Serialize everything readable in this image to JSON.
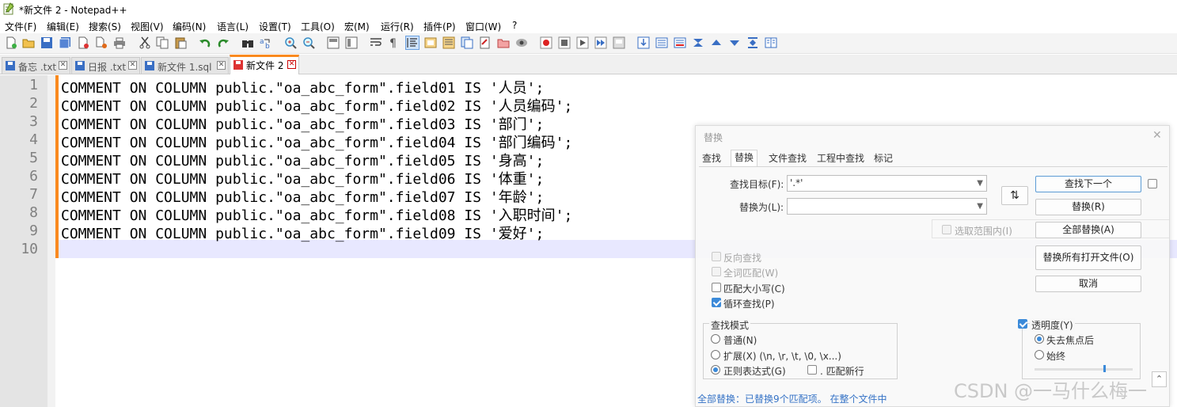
{
  "window": {
    "title": "*新文件 2 - Notepad++"
  },
  "menu": [
    "文件(F)",
    "编辑(E)",
    "搜索(S)",
    "视图(V)",
    "编码(N)",
    "语言(L)",
    "设置(T)",
    "工具(O)",
    "宏(M)",
    "运行(R)",
    "插件(P)",
    "窗口(W)",
    "?"
  ],
  "toolbar_icons": [
    "new-file-icon",
    "open-file-icon",
    "save-icon",
    "save-all-icon",
    "close-icon",
    "close-all-icon",
    "print-icon",
    "cut-icon",
    "copy-icon",
    "paste-icon",
    "undo-icon",
    "redo-icon",
    "find-icon",
    "replace-icon",
    "zoom-in-icon",
    "zoom-out-icon",
    "sync-v-icon",
    "sync-h-icon",
    "wrap-icon",
    "show-all-chars-icon",
    "indent-guide-icon",
    "lang-udl-icon",
    "doc-map-icon",
    "function-list-icon",
    "folder-workspace-icon",
    "monitor-icon",
    "record-macro-icon",
    "stop-record-icon",
    "play-macro-icon",
    "play-multi-icon",
    "save-macro-icon",
    "run-icon",
    "col-mode-icon",
    "prev-bookmark-icon",
    "fold-all-icon",
    "up-icon",
    "down-icon",
    "unfold-icon",
    "panel-icon"
  ],
  "tabs": [
    {
      "label": "备忘 .txt",
      "saved": true,
      "active": false
    },
    {
      "label": "日报 .txt",
      "saved": true,
      "active": false
    },
    {
      "label": "新文件 1.sql",
      "saved": true,
      "active": false
    },
    {
      "label": "新文件 2",
      "saved": false,
      "active": true
    }
  ],
  "editor": {
    "line_numbers": [
      "1",
      "2",
      "3",
      "4",
      "5",
      "6",
      "7",
      "8",
      "9",
      "10"
    ],
    "lines": [
      "COMMENT ON COLUMN public.\"oa_abc_form\".field01 IS '人员';",
      "COMMENT ON COLUMN public.\"oa_abc_form\".field02 IS '人员编码';",
      "COMMENT ON COLUMN public.\"oa_abc_form\".field03 IS '部门';",
      "COMMENT ON COLUMN public.\"oa_abc_form\".field04 IS '部门编码';",
      "COMMENT ON COLUMN public.\"oa_abc_form\".field05 IS '身高';",
      "COMMENT ON COLUMN public.\"oa_abc_form\".field06 IS '体重';",
      "COMMENT ON COLUMN public.\"oa_abc_form\".field07 IS '年龄';",
      "COMMENT ON COLUMN public.\"oa_abc_form\".field08 IS '入职时间';",
      "COMMENT ON COLUMN public.\"oa_abc_form\".field09 IS '爱好';",
      ""
    ]
  },
  "dialog": {
    "title": "替换",
    "close": "✕",
    "tabs": [
      "查找",
      "替换",
      "文件查找",
      "工程中查找",
      "标记"
    ],
    "find_label": "查找目标(F):",
    "find_value": "'.*'",
    "replace_label": "替换为(L):",
    "replace_value": "",
    "swap_glyph": "⇅",
    "in_selection": "选取范围内(I)",
    "buttons": {
      "find_next": "查找下一个",
      "replace": "替换(R)",
      "replace_all": "全部替换(A)",
      "replace_all_open": "替换所有打开文件(O)",
      "cancel": "取消"
    },
    "options": {
      "backward": "反向查找",
      "whole_word": "全词匹配(W)",
      "match_case": "匹配大小写(C)",
      "wrap": "循环查找(P)"
    },
    "search_mode": {
      "legend": "查找模式",
      "normal": "普通(N)",
      "extended": "扩展(X) (\\n, \\r, \\t, \\0, \\x...)",
      "regex": "正则表达式(G)",
      "dot_newline": ". 匹配新行"
    },
    "transparency": {
      "label": "透明度(Y)",
      "on_lose_focus": "失去焦点后",
      "always": "始终",
      "level": 0.7
    },
    "status": "全部替换：已替换9个匹配项。 在整个文件中"
  },
  "watermark": "CSDN @一马什么梅一"
}
